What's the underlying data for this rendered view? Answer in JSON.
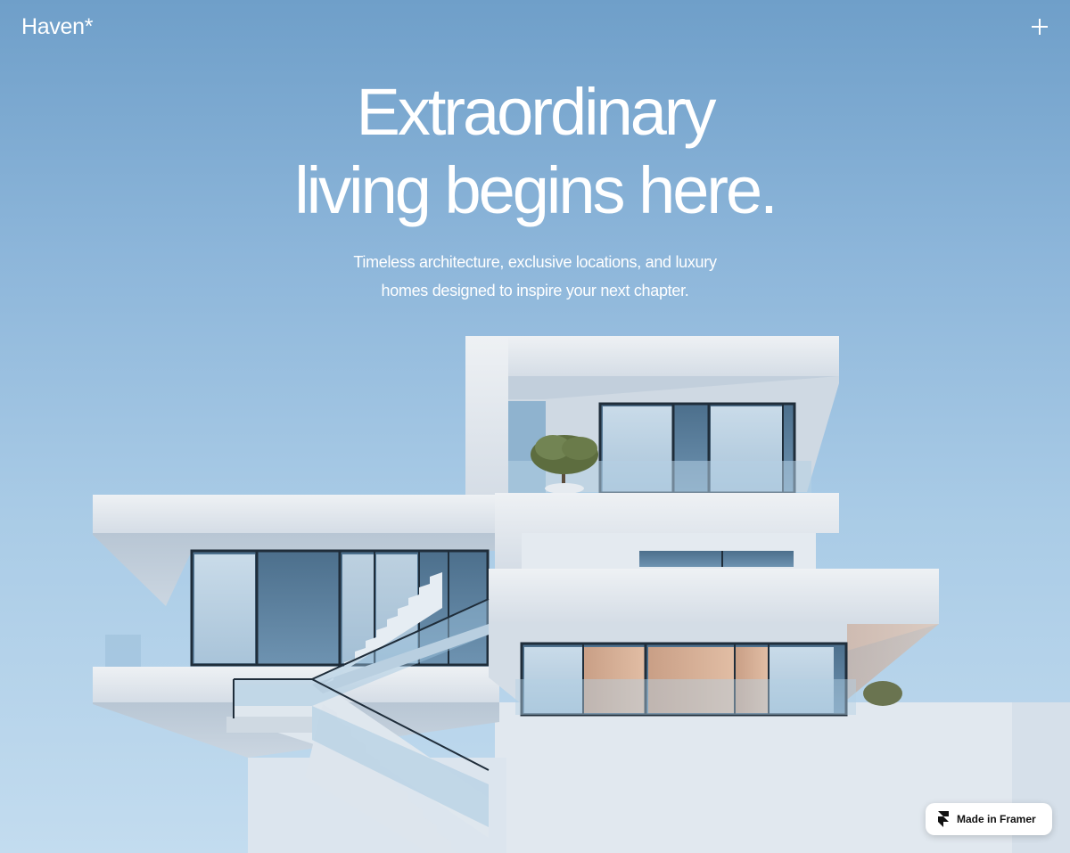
{
  "header": {
    "logo": "Haven*",
    "menu_icon": "plus-icon"
  },
  "hero": {
    "headline": [
      "Extraordinary",
      "living begins here."
    ],
    "subheadline": [
      "Timeless architecture, exclusive locations, and luxury",
      "homes designed to inspire your next chapter."
    ],
    "image": "modern-white-villa-illustration"
  },
  "badge": {
    "label": "Made in Framer",
    "icon": "framer-logo-icon"
  },
  "colors": {
    "sky_top": "#6f9fc9",
    "sky_bottom": "#c3dcef",
    "text": "#ffffff",
    "concrete": "#e9edf1",
    "glass": "#7fa9c8"
  }
}
